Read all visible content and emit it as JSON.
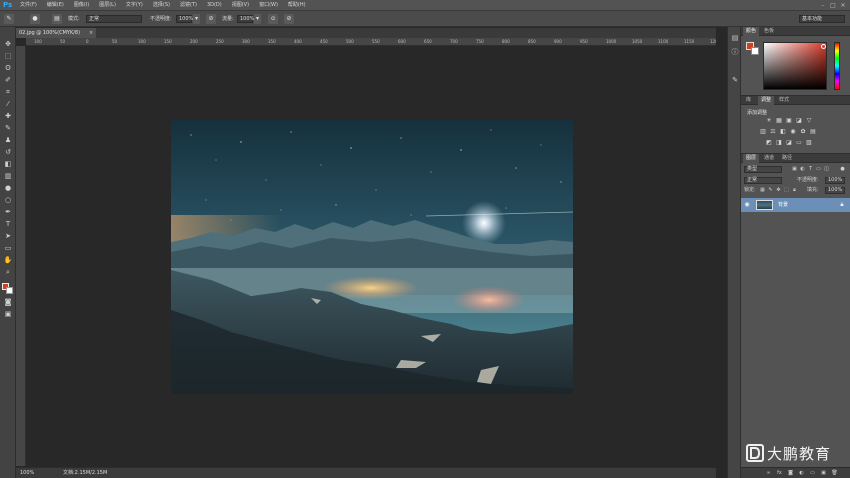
{
  "app": {
    "logo": "Ps"
  },
  "menu": [
    "文件(F)",
    "编辑(E)",
    "图像(I)",
    "图层(L)",
    "文字(Y)",
    "选择(S)",
    "滤镜(T)",
    "3D(D)",
    "视图(V)",
    "窗口(W)",
    "帮助(H)"
  ],
  "window_controls": {
    "minimize": "–",
    "maximize": "□",
    "close": "✕"
  },
  "options": {
    "mode_label": "模式:",
    "mode_value": "正常",
    "opacity_label": "不透明度:",
    "opacity_value": "100%",
    "flow_label": "流量:",
    "flow_value": "100%",
    "workspace": "基本功能"
  },
  "document": {
    "tab_title": "02.jpg @ 100%(CMYK/8)",
    "close": "×",
    "zoom": "100%",
    "info": "文档:2.15M/2.15M"
  },
  "ruler_top_ticks": [
    "100",
    "50",
    "0",
    "50",
    "100",
    "150",
    "200",
    "250",
    "300",
    "350",
    "400",
    "450",
    "500",
    "550",
    "600",
    "650",
    "700",
    "750",
    "800",
    "850",
    "900",
    "950",
    "1000",
    "1050",
    "1100",
    "1150",
    "1200"
  ],
  "panels": {
    "color_tabs": [
      "颜色",
      "色板"
    ],
    "adjust_tabs": [
      "库",
      "调整",
      "样式"
    ],
    "adjust_title": "添加调整",
    "layers_tabs": [
      "图层",
      "通道",
      "路径"
    ],
    "kind_label": "类型",
    "blend_mode": "正常",
    "opacity_label": "不透明度:",
    "opacity_value": "100%",
    "lock_label": "锁定:",
    "fill_label": "填充:",
    "fill_value": "100%",
    "layer_name": "背景"
  },
  "watermark": "大鹏教育",
  "colors": {
    "foreground": "#d4401f",
    "background": "#ffffff",
    "selected_layer": "#6c8fb7"
  }
}
